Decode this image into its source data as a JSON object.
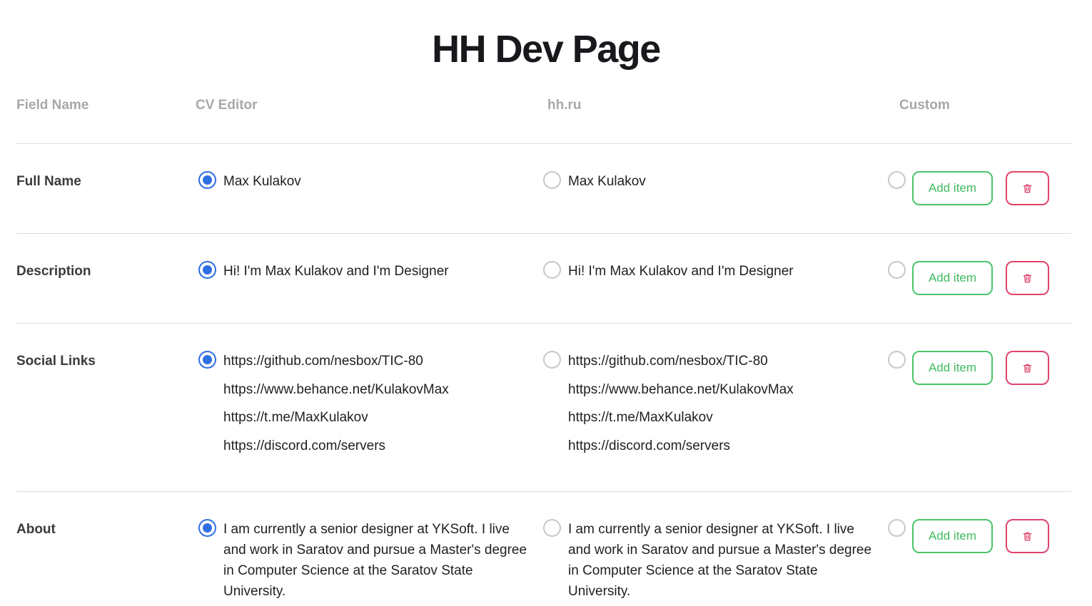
{
  "page": {
    "title": "HH Dev Page"
  },
  "table": {
    "headers": {
      "field_name": "Field Name",
      "cv_editor": "CV Editor",
      "hh": "hh.ru",
      "custom": "Custom"
    },
    "add_item_label": "Add item",
    "rows": [
      {
        "field": "Full Name",
        "cv_selected": true,
        "hh_selected": false,
        "custom_selected": false,
        "cv_values": [
          "Max Kulakov"
        ],
        "hh_values": [
          "Max Kulakov"
        ]
      },
      {
        "field": "Description",
        "cv_selected": true,
        "hh_selected": false,
        "custom_selected": false,
        "cv_values": [
          "Hi! I'm Max Kulakov and I'm Designer"
        ],
        "hh_values": [
          "Hi! I'm Max Kulakov and I'm Designer"
        ]
      },
      {
        "field": "Social Links",
        "cv_selected": true,
        "hh_selected": false,
        "custom_selected": false,
        "cv_values": [
          "https://github.com/nesbox/TIC-80",
          "https://www.behance.net/KulakovMax",
          "https://t.me/MaxKulakov",
          "https://discord.com/servers"
        ],
        "hh_values": [
          "https://github.com/nesbox/TIC-80",
          "https://www.behance.net/KulakovMax",
          "https://t.me/MaxKulakov",
          "https://discord.com/servers"
        ]
      },
      {
        "field": "About",
        "cv_selected": true,
        "hh_selected": false,
        "custom_selected": false,
        "cv_values": [
          "I am currently a senior designer at YKSoft. I live",
          "and work in Saratov and pursue a Master's degree",
          "in Computer Science at the Saratov State",
          "University."
        ],
        "hh_values": [
          "I am currently a senior designer at YKSoft. I live",
          "and work in Saratov and pursue a Master's degree",
          "in Computer Science at the Saratov State",
          "University."
        ]
      }
    ]
  },
  "colors": {
    "accent_blue": "#2f6fe0",
    "add_green": "#4bc46b",
    "delete_red": "#e0436b",
    "header_gray": "#a8a8a8"
  },
  "icons": {
    "delete": "trash-icon"
  }
}
